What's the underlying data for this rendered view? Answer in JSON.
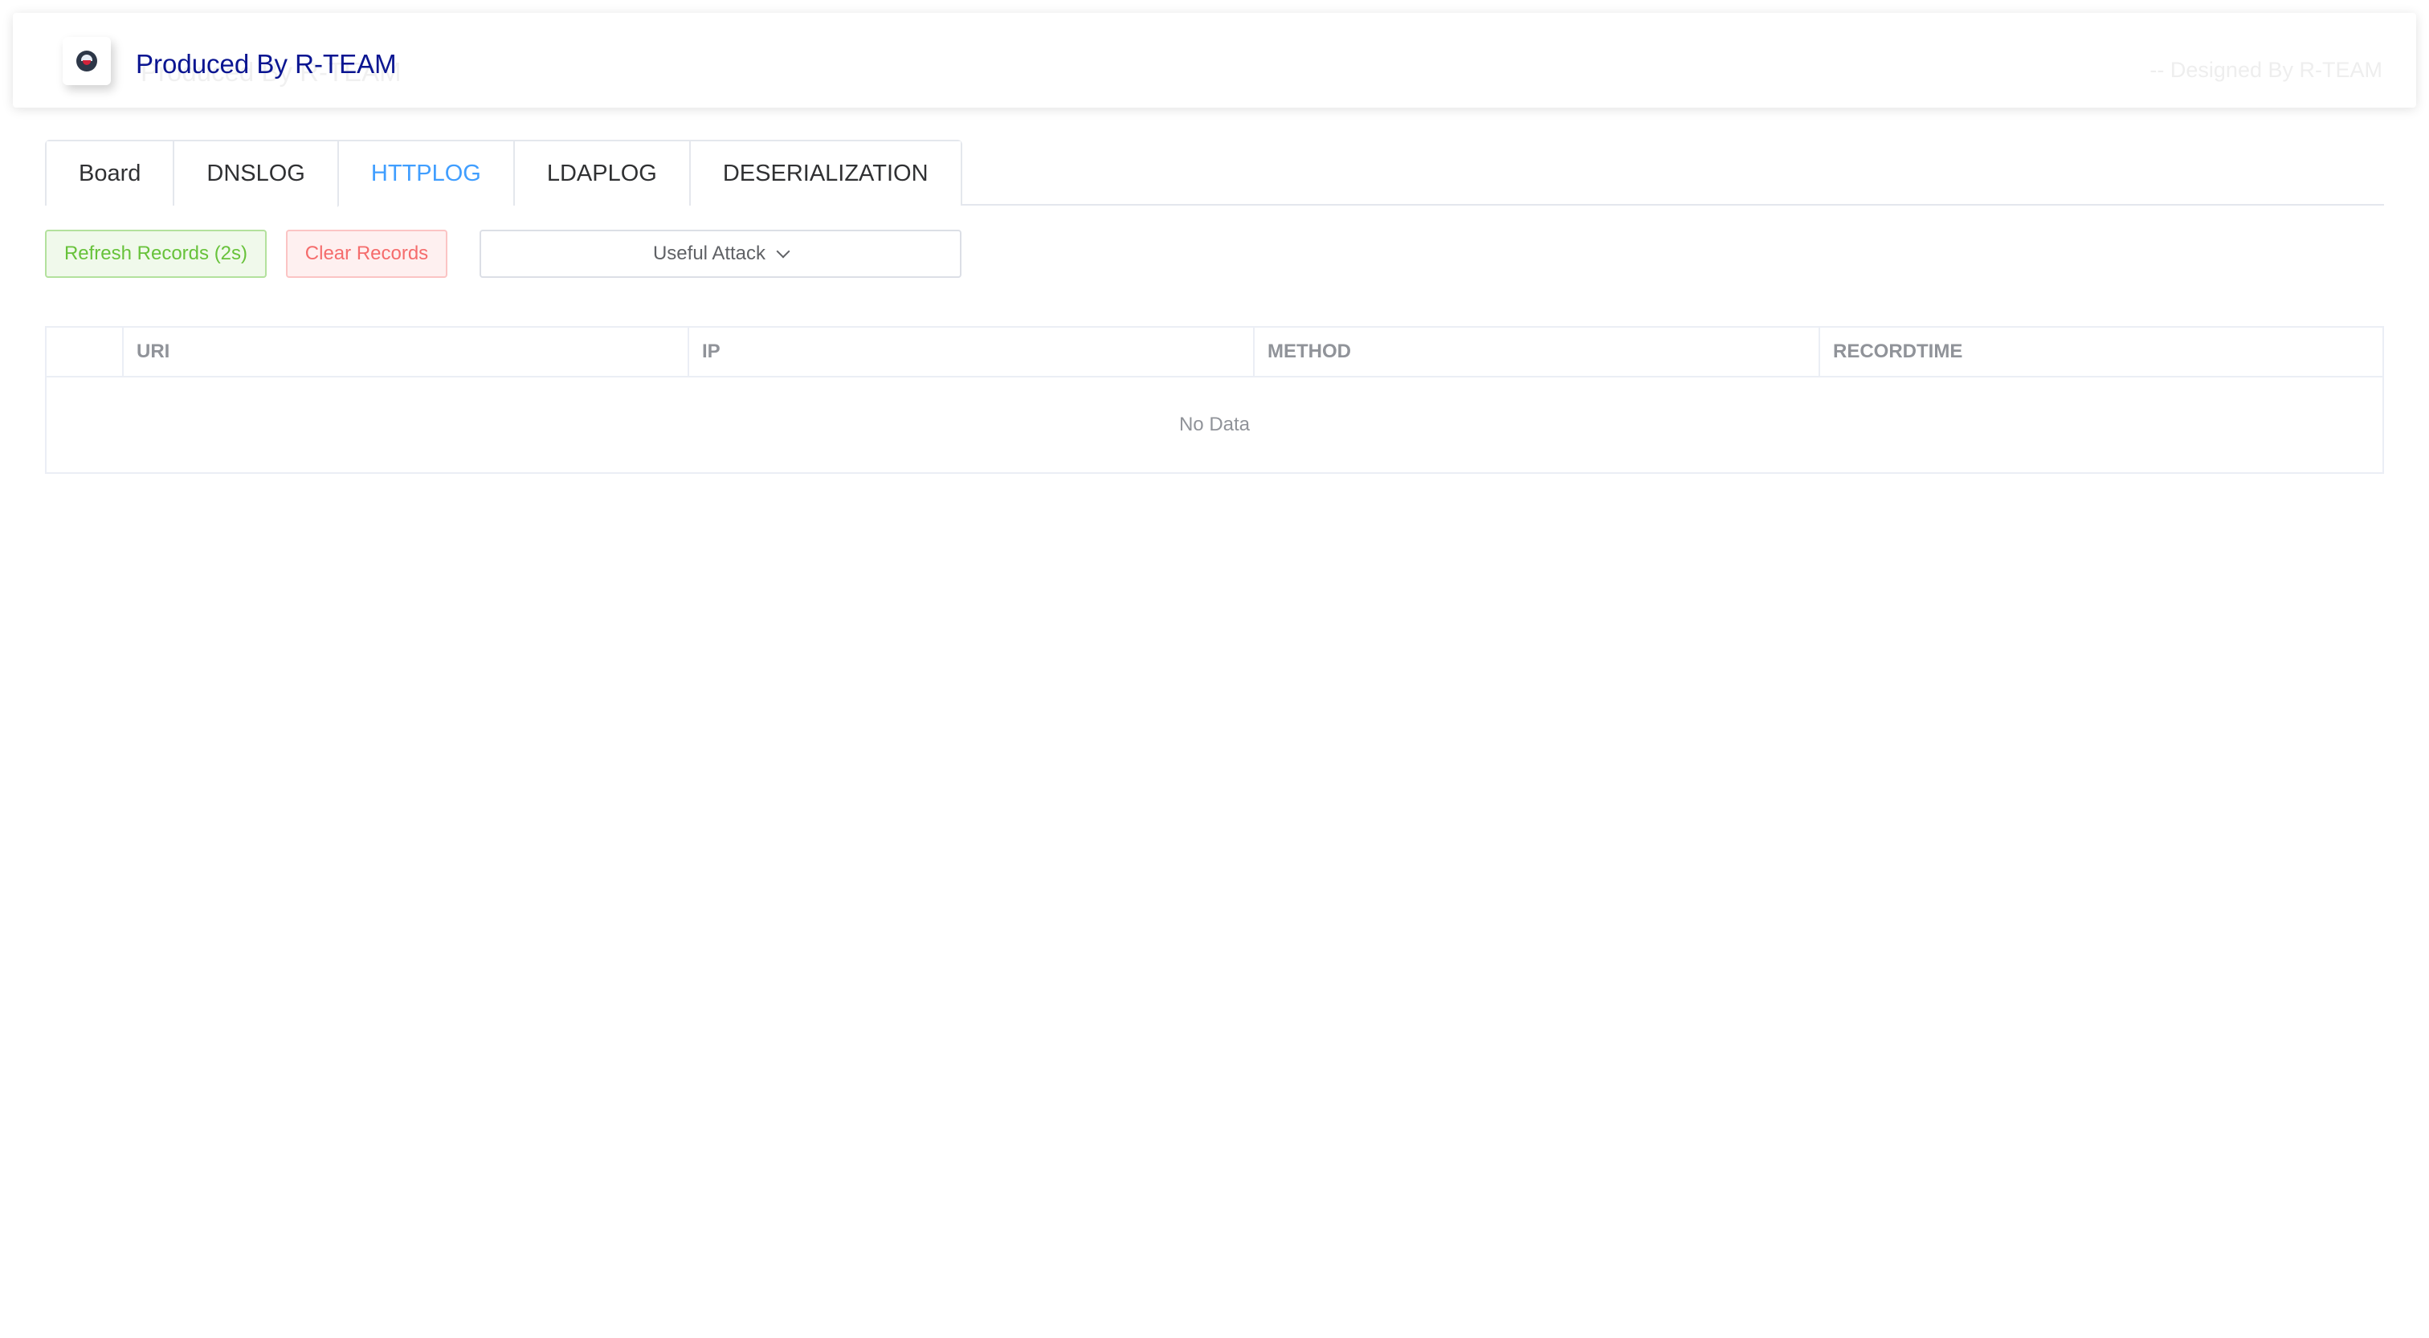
{
  "header": {
    "brand_title": "Produced By R-TEAM",
    "designed_by": "-- Designed By R-TEAM",
    "logo_icon": "pokeball-logo-icon"
  },
  "tabs": [
    {
      "label": "Board",
      "active": false
    },
    {
      "label": "DNSLOG",
      "active": false
    },
    {
      "label": "HTTPLOG",
      "active": true
    },
    {
      "label": "LDAPLOG",
      "active": false
    },
    {
      "label": "DESERIALIZATION",
      "active": false
    }
  ],
  "actions": {
    "refresh_label": "Refresh Records (2s)",
    "clear_label": "Clear Records",
    "attack_label": "Useful Attack"
  },
  "table": {
    "columns": [
      "URI",
      "IP",
      "METHOD",
      "RECORDTIME"
    ],
    "rows": [],
    "empty_text": "No Data"
  },
  "colors": {
    "brand": "#0a1591",
    "active_tab": "#409eff",
    "success": "#67c23a",
    "danger": "#f56c6c"
  }
}
